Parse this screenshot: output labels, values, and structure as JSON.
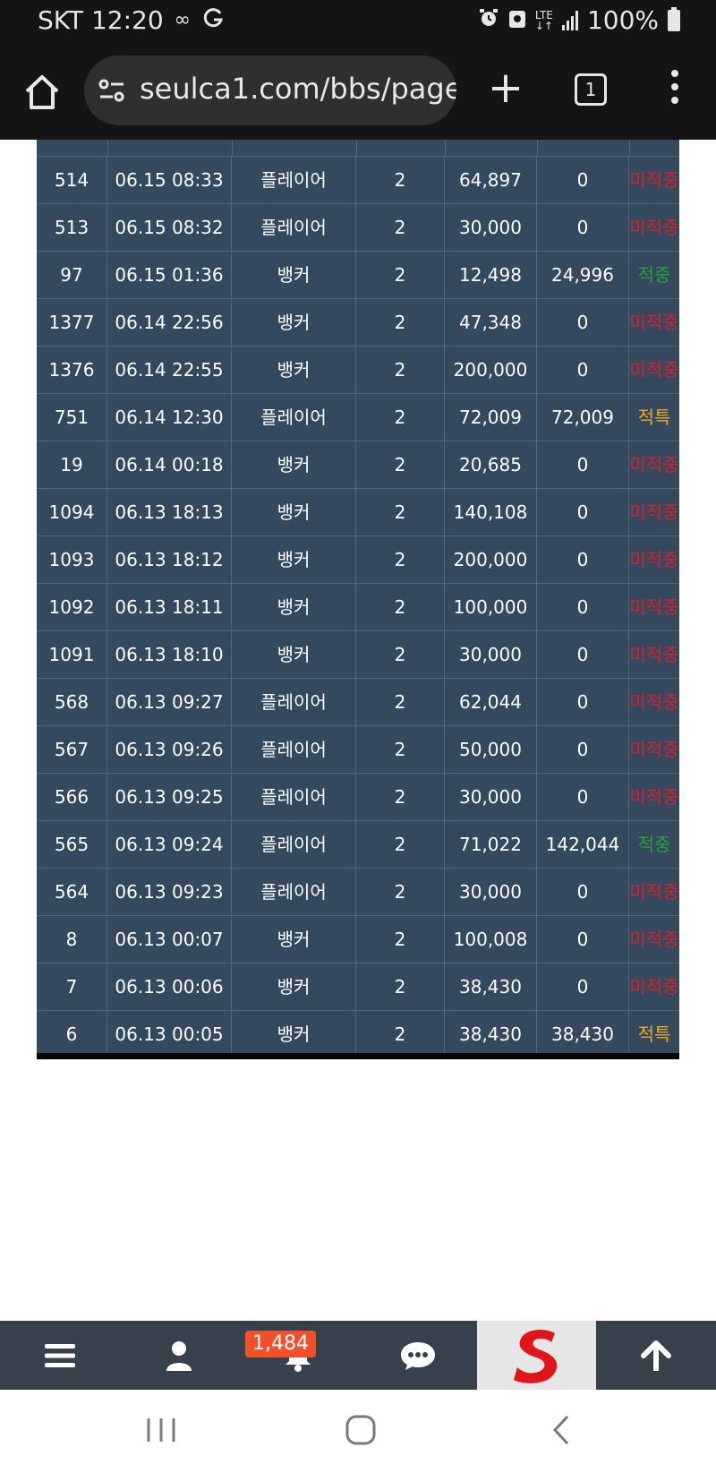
{
  "status_bar": {
    "carrier_time": "SKT 12:20",
    "battery": "100%",
    "network": "LTE",
    "icons": [
      "infinity-icon",
      "g-sync-icon",
      "alarm-icon",
      "vpn-icon",
      "lte-icon",
      "signal-icon",
      "battery-icon"
    ]
  },
  "browser": {
    "url": "seulca1.com/bbs/page",
    "tab_count": "1",
    "icons": [
      "home-icon",
      "site-settings-icon",
      "plus-icon",
      "tabs-icon",
      "more-vert-icon"
    ]
  },
  "table": {
    "rows": [
      {
        "no": "514",
        "time": "06.15 08:33",
        "pick": "플레이어",
        "odds": "2",
        "bet": "64,897",
        "win": "0",
        "result": "미적중",
        "status": "miss"
      },
      {
        "no": "513",
        "time": "06.15 08:32",
        "pick": "플레이어",
        "odds": "2",
        "bet": "30,000",
        "win": "0",
        "result": "미적중",
        "status": "miss"
      },
      {
        "no": "97",
        "time": "06.15 01:36",
        "pick": "뱅커",
        "odds": "2",
        "bet": "12,498",
        "win": "24,996",
        "result": "적중",
        "status": "hit"
      },
      {
        "no": "1377",
        "time": "06.14 22:56",
        "pick": "뱅커",
        "odds": "2",
        "bet": "47,348",
        "win": "0",
        "result": "미적중",
        "status": "miss"
      },
      {
        "no": "1376",
        "time": "06.14 22:55",
        "pick": "뱅커",
        "odds": "2",
        "bet": "200,000",
        "win": "0",
        "result": "미적중",
        "status": "miss"
      },
      {
        "no": "751",
        "time": "06.14 12:30",
        "pick": "플레이어",
        "odds": "2",
        "bet": "72,009",
        "win": "72,009",
        "result": "적특",
        "status": "special"
      },
      {
        "no": "19",
        "time": "06.14 00:18",
        "pick": "뱅커",
        "odds": "2",
        "bet": "20,685",
        "win": "0",
        "result": "미적중",
        "status": "miss"
      },
      {
        "no": "1094",
        "time": "06.13 18:13",
        "pick": "뱅커",
        "odds": "2",
        "bet": "140,108",
        "win": "0",
        "result": "미적중",
        "status": "miss"
      },
      {
        "no": "1093",
        "time": "06.13 18:12",
        "pick": "뱅커",
        "odds": "2",
        "bet": "200,000",
        "win": "0",
        "result": "미적중",
        "status": "miss"
      },
      {
        "no": "1092",
        "time": "06.13 18:11",
        "pick": "뱅커",
        "odds": "2",
        "bet": "100,000",
        "win": "0",
        "result": "미적중",
        "status": "miss"
      },
      {
        "no": "1091",
        "time": "06.13 18:10",
        "pick": "뱅커",
        "odds": "2",
        "bet": "30,000",
        "win": "0",
        "result": "미적중",
        "status": "miss"
      },
      {
        "no": "568",
        "time": "06.13 09:27",
        "pick": "플레이어",
        "odds": "2",
        "bet": "62,044",
        "win": "0",
        "result": "미적중",
        "status": "miss"
      },
      {
        "no": "567",
        "time": "06.13 09:26",
        "pick": "플레이어",
        "odds": "2",
        "bet": "50,000",
        "win": "0",
        "result": "미적중",
        "status": "miss"
      },
      {
        "no": "566",
        "time": "06.13 09:25",
        "pick": "플레이어",
        "odds": "2",
        "bet": "30,000",
        "win": "0",
        "result": "미적중",
        "status": "miss"
      },
      {
        "no": "565",
        "time": "06.13 09:24",
        "pick": "플레이어",
        "odds": "2",
        "bet": "71,022",
        "win": "142,044",
        "result": "적중",
        "status": "hit"
      },
      {
        "no": "564",
        "time": "06.13 09:23",
        "pick": "플레이어",
        "odds": "2",
        "bet": "30,000",
        "win": "0",
        "result": "미적중",
        "status": "miss"
      },
      {
        "no": "8",
        "time": "06.13 00:07",
        "pick": "뱅커",
        "odds": "2",
        "bet": "100,008",
        "win": "0",
        "result": "미적중",
        "status": "miss"
      },
      {
        "no": "7",
        "time": "06.13 00:06",
        "pick": "뱅커",
        "odds": "2",
        "bet": "38,430",
        "win": "0",
        "result": "미적중",
        "status": "miss"
      },
      {
        "no": "6",
        "time": "06.13 00:05",
        "pick": "뱅커",
        "odds": "2",
        "bet": "38,430",
        "win": "38,430",
        "result": "적특",
        "status": "special"
      }
    ]
  },
  "colors": {
    "table_bg": "#35495e",
    "miss": "#d7202c",
    "hit": "#27a23a",
    "special": "#f0a722",
    "nav_bg": "#36414b",
    "badge_bg": "#f0512a"
  },
  "bottom_nav": {
    "notification_count": "1,484",
    "items": [
      "menu-icon",
      "user-icon",
      "bell-icon",
      "chat-icon",
      "site-logo",
      "arrow-up-icon"
    ]
  },
  "system_nav": {
    "items": [
      "recent-apps-icon",
      "home-circle-icon",
      "back-icon"
    ]
  }
}
